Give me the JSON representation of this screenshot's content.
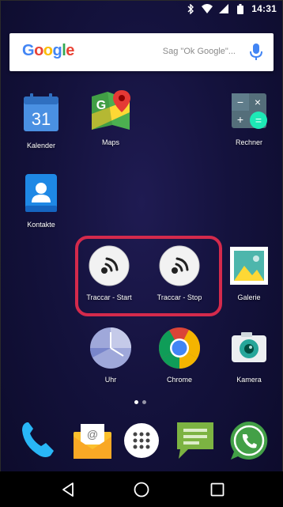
{
  "status": {
    "time": "14:31",
    "icons": [
      "bluetooth-icon",
      "wifi-icon",
      "signal-icon",
      "battery-icon"
    ]
  },
  "search": {
    "logo": "Google",
    "hint": "Sag \"Ok Google\"..."
  },
  "apps": {
    "kalender": {
      "label": "Kalender",
      "date": "31"
    },
    "maps": {
      "label": "Maps",
      "glyph": "G"
    },
    "rechner": {
      "label": "Rechner"
    },
    "kontakte": {
      "label": "Kontakte"
    },
    "traccar_start": {
      "label": "Traccar - Start"
    },
    "traccar_stop": {
      "label": "Traccar - Stop"
    },
    "galerie": {
      "label": "Galerie"
    },
    "uhr": {
      "label": "Uhr"
    },
    "chrome": {
      "label": "Chrome"
    },
    "kamera": {
      "label": "Kamera"
    }
  },
  "dock": [
    "phone-icon",
    "email-icon",
    "app-drawer-icon",
    "messages-icon",
    "whatsapp-icon"
  ],
  "colors": {
    "highlight": "#d42a4c",
    "background": "#14123d"
  },
  "page_indicator": {
    "pages": 2,
    "current": 1
  }
}
